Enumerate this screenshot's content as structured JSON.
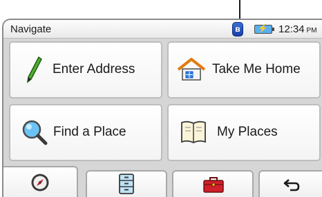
{
  "window": {
    "title": "Navigate"
  },
  "status": {
    "bluetooth_icon": "bluetooth-icon",
    "battery_icon": "battery-charging-icon",
    "time": "12:34",
    "ampm": "PM"
  },
  "menu": {
    "items": [
      {
        "label": "Enter Address",
        "icon": "pencil-icon"
      },
      {
        "label": "Take Me Home",
        "icon": "house-icon"
      },
      {
        "label": "Find a Place",
        "icon": "magnifier-icon"
      },
      {
        "label": "My Places",
        "icon": "address-book-icon"
      }
    ]
  },
  "bottom_tabs": [
    {
      "icon": "compass-icon",
      "active": true
    },
    {
      "icon": "cabinet-icon",
      "active": false
    },
    {
      "icon": "toolbox-icon",
      "active": false
    },
    {
      "icon": "back-arrow-icon",
      "active": false
    }
  ],
  "colors": {
    "accent_blue": "#1a4fc4",
    "toolbox_red": "#d11f2b",
    "pencil_green": "#3aa028"
  }
}
